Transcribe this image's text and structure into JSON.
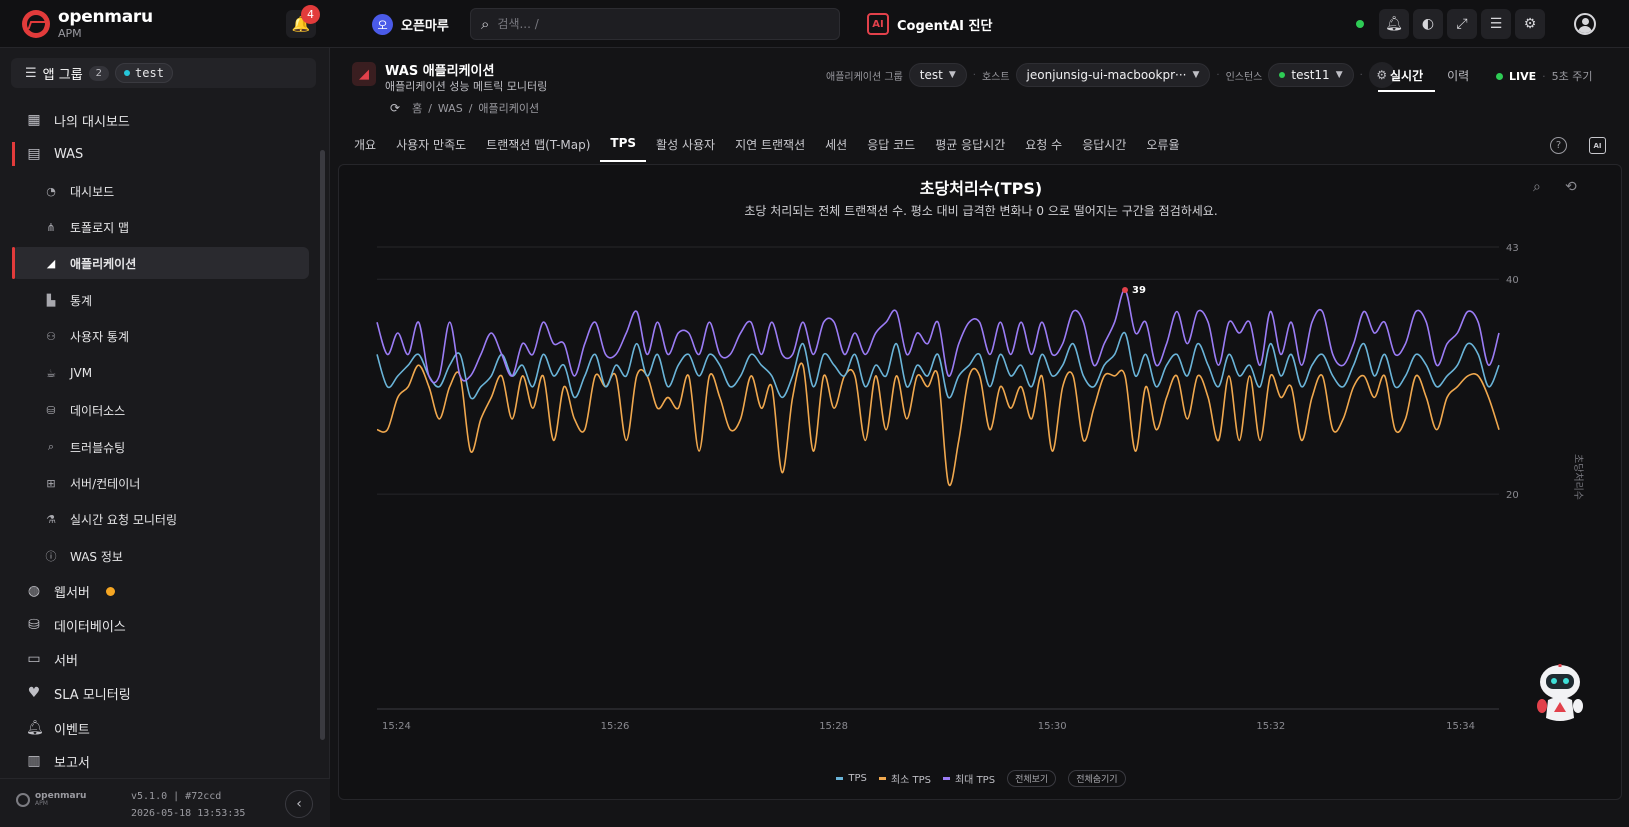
{
  "topbar": {
    "brand": "openmaru",
    "brand_sub": "APM",
    "notification_count": "4",
    "org_initial": "오",
    "org_name": "오픈마루",
    "search_placeholder": "검색... /",
    "cogent_label": "CogentAI 진단",
    "cogent_icon_text": "AI"
  },
  "sidebar": {
    "appgroup_label": "앱 그룹",
    "appgroup_count": "2",
    "appgroup_selected": "test",
    "items": [
      {
        "label": "나의 대시보드",
        "icon": "dashboard-grid-icon"
      },
      {
        "label": "WAS",
        "icon": "server-icon"
      },
      {
        "label": "대시보드",
        "icon": "gauge-icon"
      },
      {
        "label": "토폴로지 맵",
        "icon": "topology-icon"
      },
      {
        "label": "애플리케이션",
        "icon": "area-chart-icon"
      },
      {
        "label": "통계",
        "icon": "stats-chart-icon"
      },
      {
        "label": "사용자 통계",
        "icon": "users-icon"
      },
      {
        "label": "JVM",
        "icon": "coffee-icon"
      },
      {
        "label": "데이터소스",
        "icon": "database-icon"
      },
      {
        "label": "트러블슈팅",
        "icon": "search-icon"
      },
      {
        "label": "서버/컨테이너",
        "icon": "chip-icon"
      },
      {
        "label": "실시간 요청 모니터링",
        "icon": "flask-icon"
      },
      {
        "label": "WAS 정보",
        "icon": "info-icon"
      },
      {
        "label": "웹서버",
        "icon": "globe-icon"
      },
      {
        "label": "데이터베이스",
        "icon": "database-icon"
      },
      {
        "label": "서버",
        "icon": "monitor-icon"
      },
      {
        "label": "SLA 모니터링",
        "icon": "heartbeat-icon"
      },
      {
        "label": "이벤트",
        "icon": "bell-icon"
      },
      {
        "label": "보고서",
        "icon": "report-icon"
      }
    ],
    "footer": {
      "brand": "openmaru",
      "brand_sub": "APM",
      "version": "v5.1.0 | #72ccd",
      "build_time": "2026-05-18 13:53:35"
    }
  },
  "page": {
    "title": "WAS 애플리케이션",
    "subtitle": "애플리케이션 성능 메트릭 모니터링",
    "breadcrumb": [
      "홈",
      "WAS",
      "애플리케이션"
    ],
    "filters": {
      "group_label": "애플리케이션 그룹",
      "group_value": "test",
      "host_label": "호스트",
      "host_value": "jeonjunsig-ui-macbookpr···",
      "instance_label": "인스턴스",
      "instance_value": "test11"
    },
    "modes": [
      "실시간",
      "이력"
    ],
    "live_label": "LIVE",
    "period": "5초 주기",
    "tabs": [
      "개요",
      "사용자 만족도",
      "트랜잭션 맵(T-Map)",
      "TPS",
      "활성 사용자",
      "지연 트랜잭션",
      "세션",
      "응답 코드",
      "평균 응답시간",
      "요청 수",
      "응답시간",
      "오류율"
    ],
    "active_tab": "TPS"
  },
  "chart_data": {
    "type": "line",
    "title": "초당처리수(TPS)",
    "subtitle": "초당 처리되는 전체 트랜잭션 수. 평소 대비 급격한 변화나 0 으로 떨어지는 구간을 점검하세요.",
    "ylabel": "초당처리수",
    "ylim": [
      0,
      43
    ],
    "yticks": [
      20,
      40,
      43
    ],
    "xticks": [
      "15:24",
      "15:26",
      "15:28",
      "15:30",
      "15:32",
      "15:34"
    ],
    "x_range": [
      "15:24:00",
      "15:34:15"
    ],
    "peak_label": "39",
    "peak_index": 72,
    "legend": [
      "TPS",
      "최소 TPS",
      "최대 TPS"
    ],
    "legend_buttons": [
      "전체보기",
      "전체숨기기"
    ],
    "colors": {
      "TPS": "#6ab4d8",
      "최소 TPS": "#f0a84e",
      "최대 TPS": "#9b7cf5",
      "peak": "#e2414b"
    },
    "series": [
      {
        "name": "TPS",
        "values": [
          33,
          30,
          31,
          32,
          33,
          31,
          30,
          32,
          33,
          29,
          30,
          31,
          33,
          31,
          32,
          30,
          33,
          31,
          32,
          29,
          31,
          33,
          30,
          32,
          31,
          34,
          31,
          33,
          30,
          32,
          33,
          31,
          33,
          32,
          30,
          31,
          33,
          32,
          31,
          29,
          31,
          34,
          30,
          33,
          32,
          31,
          33,
          30,
          32,
          31,
          34,
          30,
          32,
          31,
          33,
          29,
          31,
          32,
          33,
          30,
          33,
          31,
          32,
          30,
          33,
          31,
          32,
          34,
          31,
          30,
          32,
          33,
          35,
          31,
          33,
          30,
          32,
          33,
          31,
          34,
          32,
          30,
          33,
          31,
          32,
          30,
          34,
          31,
          33,
          30,
          32,
          33,
          31,
          30,
          32,
          34,
          31,
          33,
          30,
          31,
          33,
          32,
          30,
          31,
          32,
          34,
          33,
          30,
          32
        ]
      },
      {
        "name": "최소 TPS",
        "values": [
          26,
          26,
          29,
          30,
          32,
          30,
          27,
          30,
          31,
          24,
          27,
          29,
          31,
          27,
          31,
          28,
          31,
          25,
          30,
          27,
          26,
          31,
          30,
          31,
          25,
          31,
          31,
          28,
          29,
          28,
          31,
          24,
          31,
          29,
          26,
          27,
          31,
          28,
          30,
          22,
          29,
          32,
          24,
          31,
          28,
          31,
          31,
          25,
          31,
          26,
          31,
          27,
          31,
          30,
          31,
          21,
          25,
          31,
          31,
          26,
          30,
          28,
          30,
          27,
          31,
          24,
          30,
          31,
          25,
          28,
          31,
          31,
          31,
          24,
          30,
          26,
          29,
          31,
          27,
          31,
          29,
          25,
          31,
          25,
          31,
          25,
          31,
          29,
          30,
          25,
          29,
          31,
          26,
          27,
          30,
          31,
          29,
          31,
          26,
          27,
          31,
          29,
          26,
          29,
          30,
          31,
          31,
          29,
          26
        ]
      },
      {
        "name": "최대 TPS",
        "values": [
          36,
          33,
          35,
          33,
          36,
          31,
          31,
          36,
          31,
          31,
          33,
          35,
          33,
          31,
          34,
          33,
          36,
          34,
          34,
          31,
          34,
          36,
          33,
          33,
          35,
          37,
          33,
          36,
          33,
          35,
          35,
          33,
          36,
          33,
          33,
          35,
          36,
          33,
          36,
          33,
          33,
          36,
          33,
          36,
          36,
          33,
          35,
          33,
          35,
          36,
          37,
          33,
          35,
          34,
          36,
          31,
          34,
          36,
          36,
          33,
          36,
          33,
          36,
          33,
          36,
          33,
          34,
          37,
          36,
          32,
          34,
          36,
          39,
          35,
          36,
          32,
          34,
          37,
          34,
          37,
          36,
          32,
          36,
          35,
          36,
          32,
          37,
          33,
          36,
          32,
          36,
          37,
          33,
          32,
          34,
          37,
          35,
          36,
          33,
          34,
          37,
          36,
          32,
          34,
          35,
          37,
          36,
          32,
          35
        ]
      }
    ]
  }
}
